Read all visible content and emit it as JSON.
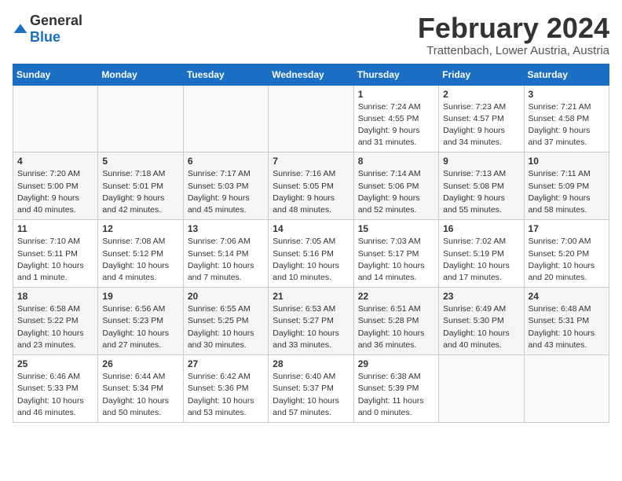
{
  "logo": {
    "general": "General",
    "blue": "Blue"
  },
  "title": "February 2024",
  "location": "Trattenbach, Lower Austria, Austria",
  "weekdays": [
    "Sunday",
    "Monday",
    "Tuesday",
    "Wednesday",
    "Thursday",
    "Friday",
    "Saturday"
  ],
  "weeks": [
    [
      {
        "day": "",
        "info": ""
      },
      {
        "day": "",
        "info": ""
      },
      {
        "day": "",
        "info": ""
      },
      {
        "day": "",
        "info": ""
      },
      {
        "day": "1",
        "info": "Sunrise: 7:24 AM\nSunset: 4:55 PM\nDaylight: 9 hours\nand 31 minutes."
      },
      {
        "day": "2",
        "info": "Sunrise: 7:23 AM\nSunset: 4:57 PM\nDaylight: 9 hours\nand 34 minutes."
      },
      {
        "day": "3",
        "info": "Sunrise: 7:21 AM\nSunset: 4:58 PM\nDaylight: 9 hours\nand 37 minutes."
      }
    ],
    [
      {
        "day": "4",
        "info": "Sunrise: 7:20 AM\nSunset: 5:00 PM\nDaylight: 9 hours\nand 40 minutes."
      },
      {
        "day": "5",
        "info": "Sunrise: 7:18 AM\nSunset: 5:01 PM\nDaylight: 9 hours\nand 42 minutes."
      },
      {
        "day": "6",
        "info": "Sunrise: 7:17 AM\nSunset: 5:03 PM\nDaylight: 9 hours\nand 45 minutes."
      },
      {
        "day": "7",
        "info": "Sunrise: 7:16 AM\nSunset: 5:05 PM\nDaylight: 9 hours\nand 48 minutes."
      },
      {
        "day": "8",
        "info": "Sunrise: 7:14 AM\nSunset: 5:06 PM\nDaylight: 9 hours\nand 52 minutes."
      },
      {
        "day": "9",
        "info": "Sunrise: 7:13 AM\nSunset: 5:08 PM\nDaylight: 9 hours\nand 55 minutes."
      },
      {
        "day": "10",
        "info": "Sunrise: 7:11 AM\nSunset: 5:09 PM\nDaylight: 9 hours\nand 58 minutes."
      }
    ],
    [
      {
        "day": "11",
        "info": "Sunrise: 7:10 AM\nSunset: 5:11 PM\nDaylight: 10 hours\nand 1 minute."
      },
      {
        "day": "12",
        "info": "Sunrise: 7:08 AM\nSunset: 5:12 PM\nDaylight: 10 hours\nand 4 minutes."
      },
      {
        "day": "13",
        "info": "Sunrise: 7:06 AM\nSunset: 5:14 PM\nDaylight: 10 hours\nand 7 minutes."
      },
      {
        "day": "14",
        "info": "Sunrise: 7:05 AM\nSunset: 5:16 PM\nDaylight: 10 hours\nand 10 minutes."
      },
      {
        "day": "15",
        "info": "Sunrise: 7:03 AM\nSunset: 5:17 PM\nDaylight: 10 hours\nand 14 minutes."
      },
      {
        "day": "16",
        "info": "Sunrise: 7:02 AM\nSunset: 5:19 PM\nDaylight: 10 hours\nand 17 minutes."
      },
      {
        "day": "17",
        "info": "Sunrise: 7:00 AM\nSunset: 5:20 PM\nDaylight: 10 hours\nand 20 minutes."
      }
    ],
    [
      {
        "day": "18",
        "info": "Sunrise: 6:58 AM\nSunset: 5:22 PM\nDaylight: 10 hours\nand 23 minutes."
      },
      {
        "day": "19",
        "info": "Sunrise: 6:56 AM\nSunset: 5:23 PM\nDaylight: 10 hours\nand 27 minutes."
      },
      {
        "day": "20",
        "info": "Sunrise: 6:55 AM\nSunset: 5:25 PM\nDaylight: 10 hours\nand 30 minutes."
      },
      {
        "day": "21",
        "info": "Sunrise: 6:53 AM\nSunset: 5:27 PM\nDaylight: 10 hours\nand 33 minutes."
      },
      {
        "day": "22",
        "info": "Sunrise: 6:51 AM\nSunset: 5:28 PM\nDaylight: 10 hours\nand 36 minutes."
      },
      {
        "day": "23",
        "info": "Sunrise: 6:49 AM\nSunset: 5:30 PM\nDaylight: 10 hours\nand 40 minutes."
      },
      {
        "day": "24",
        "info": "Sunrise: 6:48 AM\nSunset: 5:31 PM\nDaylight: 10 hours\nand 43 minutes."
      }
    ],
    [
      {
        "day": "25",
        "info": "Sunrise: 6:46 AM\nSunset: 5:33 PM\nDaylight: 10 hours\nand 46 minutes."
      },
      {
        "day": "26",
        "info": "Sunrise: 6:44 AM\nSunset: 5:34 PM\nDaylight: 10 hours\nand 50 minutes."
      },
      {
        "day": "27",
        "info": "Sunrise: 6:42 AM\nSunset: 5:36 PM\nDaylight: 10 hours\nand 53 minutes."
      },
      {
        "day": "28",
        "info": "Sunrise: 6:40 AM\nSunset: 5:37 PM\nDaylight: 10 hours\nand 57 minutes."
      },
      {
        "day": "29",
        "info": "Sunrise: 6:38 AM\nSunset: 5:39 PM\nDaylight: 11 hours\nand 0 minutes."
      },
      {
        "day": "",
        "info": ""
      },
      {
        "day": "",
        "info": ""
      }
    ]
  ]
}
